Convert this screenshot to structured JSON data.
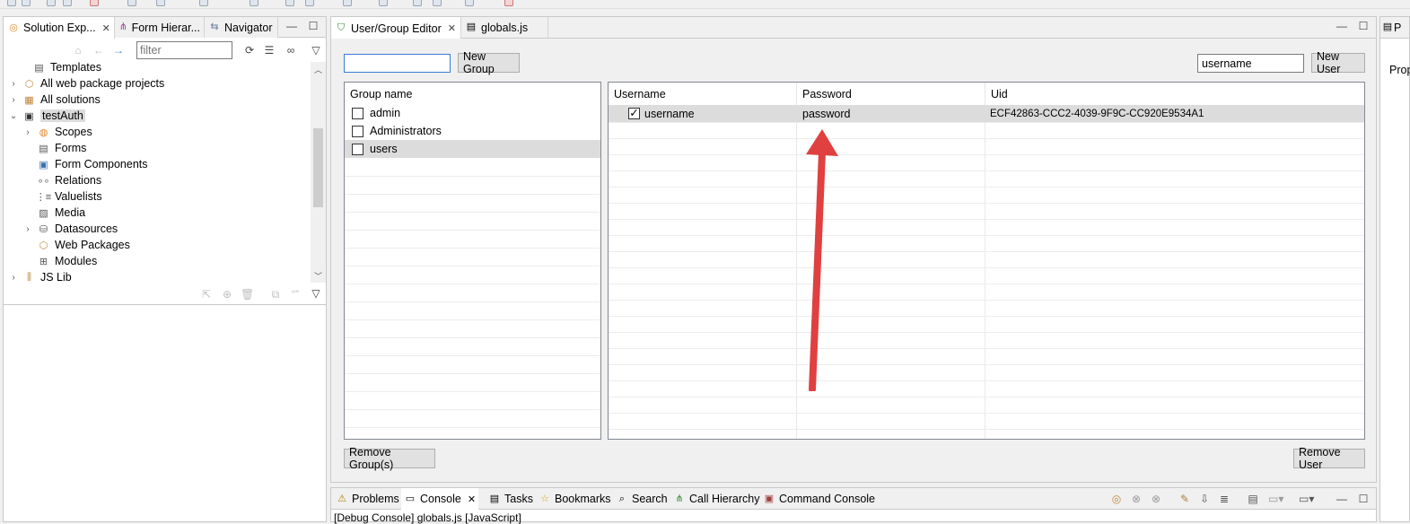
{
  "left_panel": {
    "tabs": [
      {
        "label": "Solution Exp...",
        "icon": "solution-explorer-icon"
      },
      {
        "label": "Form Hierar...",
        "icon": "form-hierarchy-icon"
      },
      {
        "label": "Navigator",
        "icon": "navigator-icon"
      }
    ],
    "filter_placeholder": "filter",
    "tree": [
      {
        "label": "Templates",
        "icon": "templates-icon"
      },
      {
        "label": "All web package projects",
        "icon": "package-icon"
      },
      {
        "label": "All solutions",
        "icon": "solutions-icon"
      },
      {
        "label": "testAuth",
        "icon": "solution-icon"
      },
      {
        "label": "Scopes",
        "icon": "scopes-icon"
      },
      {
        "label": "Forms",
        "icon": "forms-icon"
      },
      {
        "label": "Form Components",
        "icon": "form-components-icon"
      },
      {
        "label": "Relations",
        "icon": "relations-icon"
      },
      {
        "label": "Valuelists",
        "icon": "valuelists-icon"
      },
      {
        "label": "Media",
        "icon": "media-icon"
      },
      {
        "label": "Datasources",
        "icon": "datasources-icon"
      },
      {
        "label": "Web Packages",
        "icon": "web-packages-icon"
      },
      {
        "label": "Modules",
        "icon": "modules-icon"
      },
      {
        "label": "JS Lib",
        "icon": "js-lib-icon"
      }
    ]
  },
  "editor": {
    "tabs": [
      {
        "label": "User/Group Editor",
        "icon": "shield-icon"
      },
      {
        "label": "globals.js",
        "icon": "js-file-icon"
      }
    ],
    "group_input_value": "",
    "new_group_label": "New Group",
    "user_input_value": "username",
    "new_user_label": "New User",
    "group_table": {
      "header": "Group name",
      "rows": [
        {
          "name": "admin",
          "checked": false
        },
        {
          "name": "Administrators",
          "checked": false
        },
        {
          "name": "users",
          "checked": false
        }
      ]
    },
    "user_table": {
      "headers": [
        "Username",
        "Password",
        "Uid"
      ],
      "rows": [
        {
          "username": "username",
          "password": "password",
          "uid": "ECF42863-CCC2-4039-9F9C-CC920E9534A1",
          "checked": true
        }
      ]
    },
    "remove_group_label": "Remove Group(s)",
    "remove_user_label": "Remove User"
  },
  "right_panel": {
    "tab_label": "P",
    "content_label": "Prop"
  },
  "bottom_panel": {
    "tabs": [
      {
        "label": "Problems",
        "icon": "warning-icon"
      },
      {
        "label": "Console",
        "icon": "console-icon"
      },
      {
        "label": "Tasks",
        "icon": "tasks-icon"
      },
      {
        "label": "Bookmarks",
        "icon": "bookmark-icon"
      },
      {
        "label": "Search",
        "icon": "search-icon"
      },
      {
        "label": "Call Hierarchy",
        "icon": "call-hierarchy-icon"
      },
      {
        "label": "Command Console",
        "icon": "command-console-icon"
      }
    ],
    "console_text": "[Debug Console] globals.js [JavaScript]"
  },
  "annotation": {
    "arrow_color": "#e04040"
  }
}
